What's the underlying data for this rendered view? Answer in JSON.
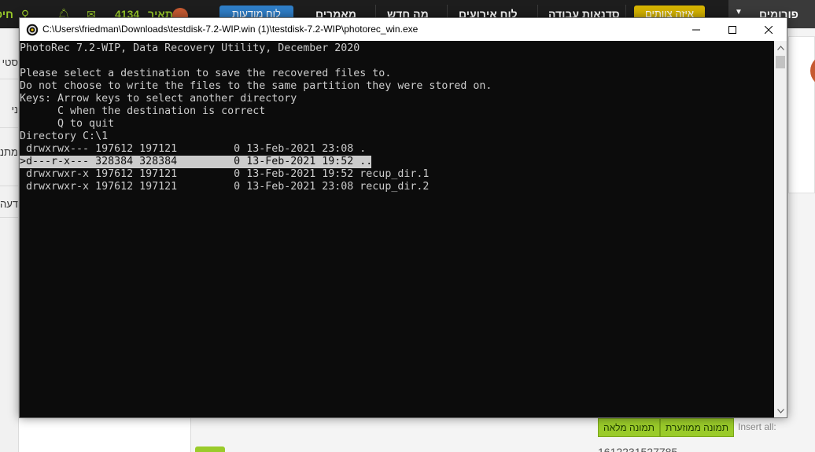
{
  "site": {
    "nav": {
      "favorites": "פורומים",
      "create_team": "איזה צוותים",
      "workshop": "סדנאות עבודה",
      "event_board": "לוח אירועים",
      "whats_new": "מה חדש",
      "articles": "מאמרים",
      "news_board": "לוח מודעות",
      "user_points": "4134",
      "user_label": "תאיר",
      "left_frag": "חיפ"
    },
    "left_fragments": [
      "סטי",
      "ני",
      "מתנ",
      "דעה"
    ],
    "bottom": {
      "insert_all": "Insert all:",
      "reduced_image": "תמונה ממוזערת",
      "full_image": "תמונה מלאה",
      "cut_number": "1612231527785"
    }
  },
  "window": {
    "title": "C:\\Users\\friedman\\Downloads\\testdisk-7.2-WIP.win (1)\\testdisk-7.2-WIP\\photorec_win.exe",
    "icon": "photorec-app-icon",
    "buttons": {
      "minimize": "minimize-icon",
      "maximize": "maximize-icon",
      "close": "close-icon"
    }
  },
  "console": {
    "header": "PhotoRec 7.2-WIP, Data Recovery Utility, December 2020",
    "instructions": [
      "Please select a destination to save the recovered files to.",
      "Do not choose to write the files to the same partition they were stored on.",
      "Keys: Arrow keys to select another directory",
      "      C when the destination is correct",
      "      Q to quit"
    ],
    "directory": "Directory C:\\1",
    "entries": [
      " drwxrwx--- 197612 197121         0 13-Feb-2021 23:08 .",
      ">d---r-x--- 328384 328384         0 13-Feb-2021 19:52 ..",
      " drwxrwxr-x 197612 197121         0 13-Feb-2021 19:52 recup_dir.1",
      " drwxrwxr-x 197612 197121         0 13-Feb-2021 23:08 recup_dir.2"
    ],
    "selected_index": 1
  },
  "colors": {
    "console_bg": "#0c0c0c",
    "console_fg": "#cccccc",
    "selection_bg": "#cccccc",
    "site_nav_bg": "#1d1d1d",
    "site_accent_green": "#9acb2a",
    "site_button_blue": "#2f7ec7",
    "site_button_yellow": "#d6b400"
  }
}
